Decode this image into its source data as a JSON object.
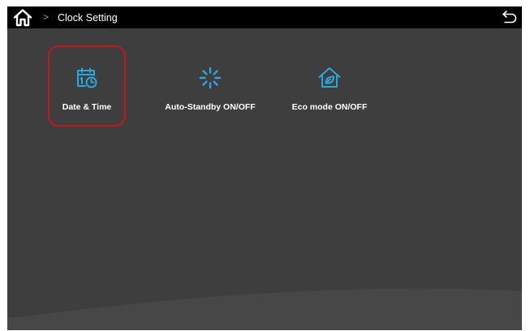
{
  "header": {
    "breadcrumb_separator": ">",
    "title": "Clock Setting",
    "home_icon": "home-icon",
    "back_icon": "back-arrow-icon"
  },
  "tiles": [
    {
      "label": "Date & Time",
      "icon": "calendar-clock-icon",
      "selected": true
    },
    {
      "label": "Auto-Standby ON/OFF",
      "icon": "standby-loader-icon",
      "selected": false
    },
    {
      "label": "Eco mode ON/OFF",
      "icon": "eco-home-leaf-icon",
      "selected": false
    }
  ],
  "colors": {
    "background": "#3e3e3e",
    "topbar": "#000000",
    "accent_icon": "#29a8e0",
    "selection_ring": "#c4161c",
    "text": "#ffffff"
  }
}
